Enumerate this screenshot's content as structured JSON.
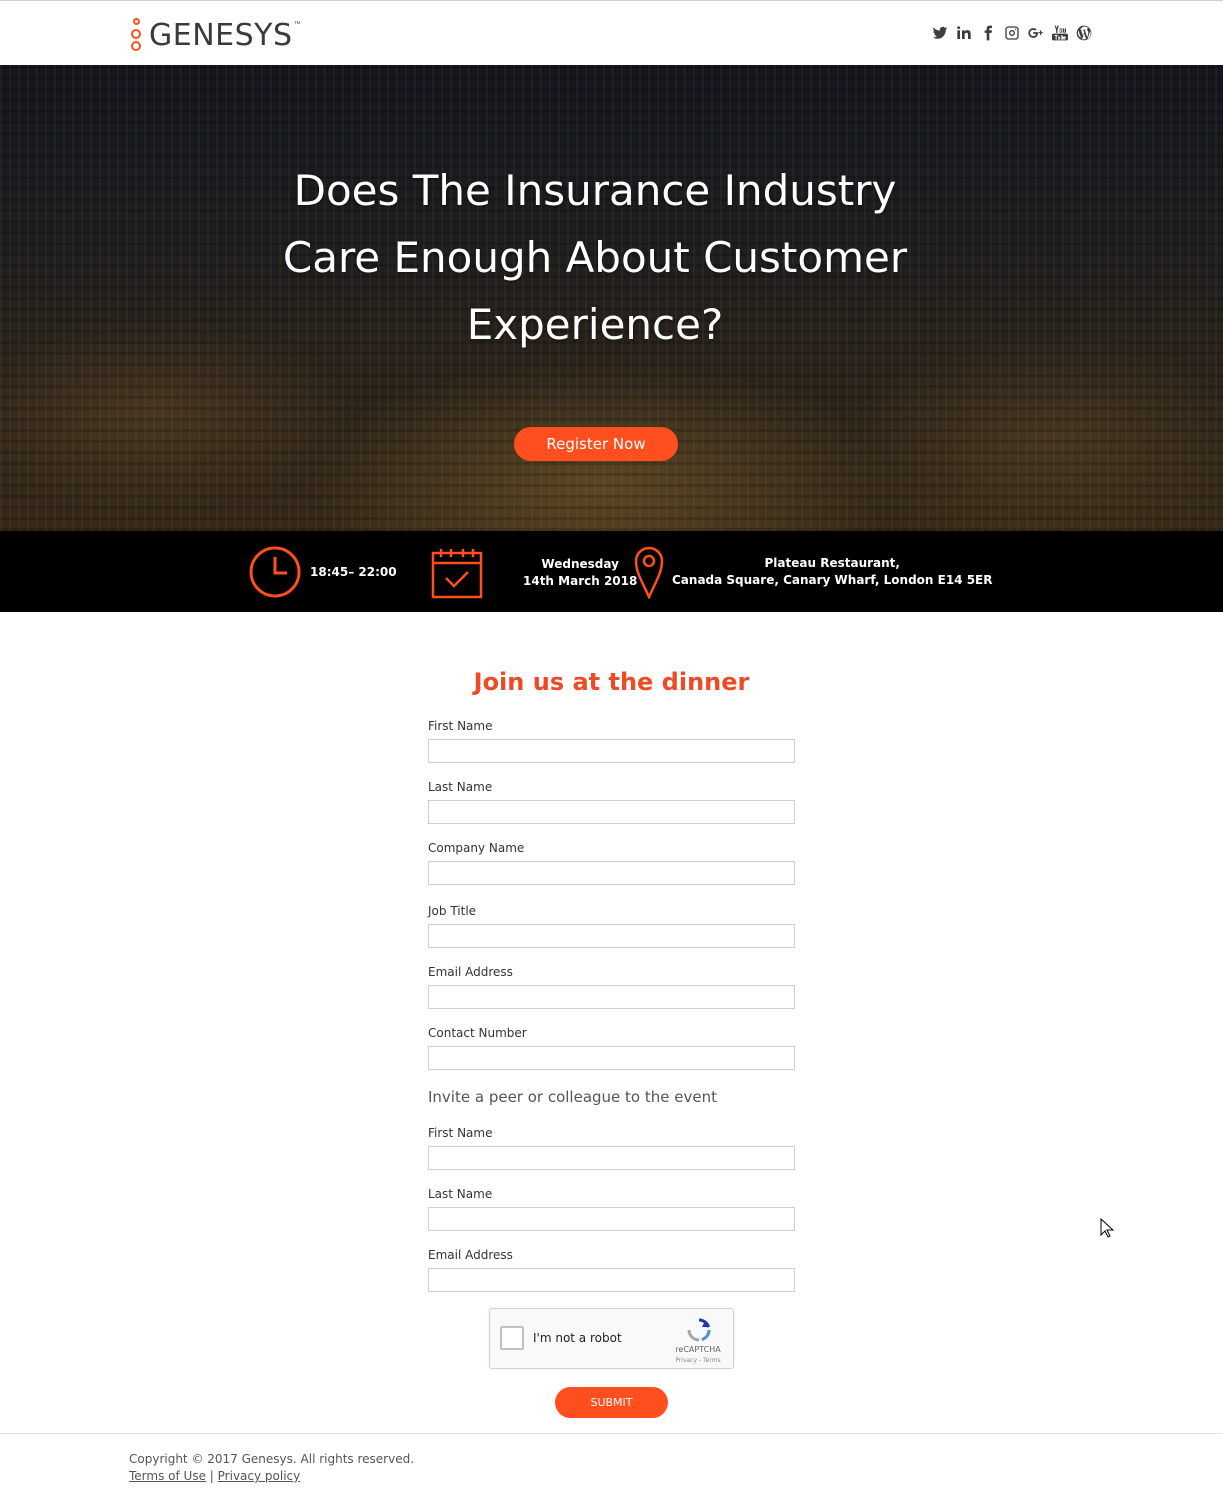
{
  "header": {
    "logo_text": "GENESYS",
    "logo_tm": "™",
    "social": [
      "twitter-icon",
      "linkedin-icon",
      "facebook-icon",
      "instagram-icon",
      "google-plus-icon",
      "youtube-icon",
      "wordpress-icon"
    ]
  },
  "hero": {
    "title_line1": "Does The Insurance Industry",
    "title_line2": "Care Enough About Customer",
    "title_line3": "Experience?",
    "register_label": "Register Now"
  },
  "info": {
    "time": "18:45– 22:00",
    "day": "Wednesday",
    "date": "14th March 2018",
    "venue": "Plateau Restaurant,",
    "address": "Canada Square, Canary Wharf, London E14 5ER"
  },
  "form": {
    "title": "Join us at the dinner",
    "fields": [
      {
        "label": "First Name",
        "value": ""
      },
      {
        "label": "Last Name",
        "value": ""
      },
      {
        "label": "Company Name",
        "value": ""
      },
      {
        "label": "Job Title",
        "value": ""
      },
      {
        "label": "Email Address",
        "value": ""
      },
      {
        "label": "Contact Number",
        "value": ""
      }
    ],
    "invite_heading": "Invite a peer or colleague to the event",
    "invite_fields": [
      {
        "label": "First Name",
        "value": ""
      },
      {
        "label": "Last Name",
        "value": ""
      },
      {
        "label": "Email Address",
        "value": ""
      }
    ],
    "captcha_label": "I'm not a robot",
    "captcha_brand": "reCAPTCHA",
    "captcha_terms": "Privacy - Terms",
    "submit_label": "SUBMIT"
  },
  "footer": {
    "copyright": "Copyright © 2017 Genesys. All rights reserved.",
    "terms": "Terms of Use",
    "separator": "|",
    "privacy": "Privacy policy"
  },
  "colors": {
    "accent": "#ff4f1f",
    "title": "#ee4b24",
    "infobar": "#000000"
  }
}
